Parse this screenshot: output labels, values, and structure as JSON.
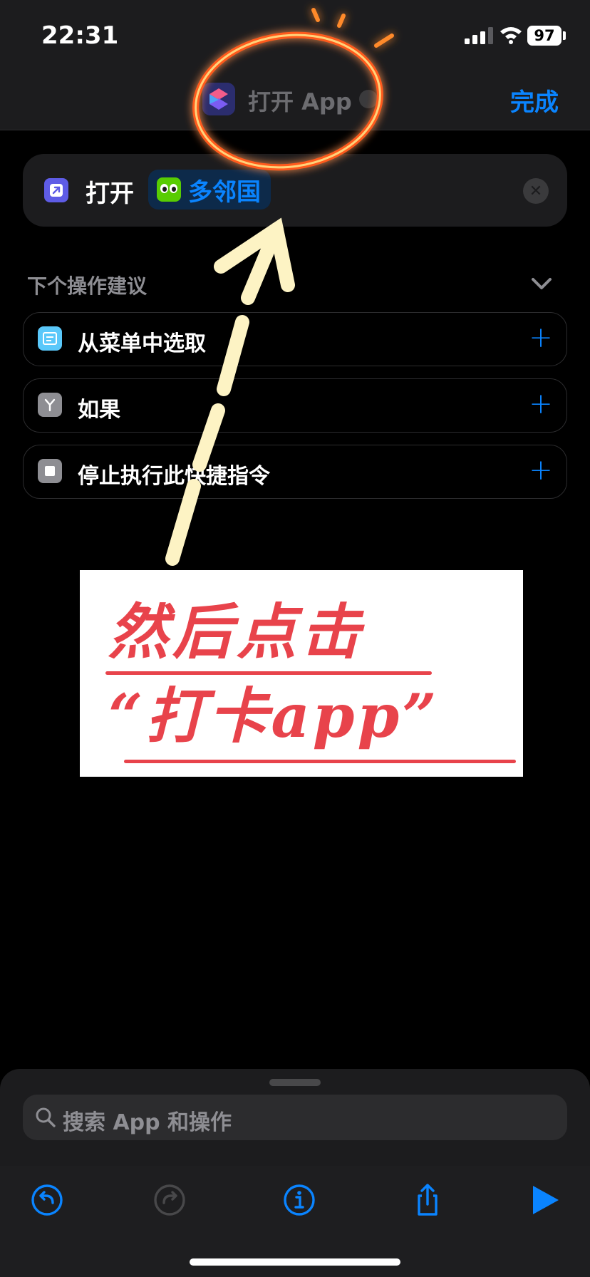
{
  "status_bar": {
    "time": "22:31",
    "battery": "97"
  },
  "nav": {
    "title": "打开 App",
    "done_label": "完成"
  },
  "action": {
    "verb": "打开",
    "app_name": "多邻国"
  },
  "suggestions": {
    "header": "下个操作建议",
    "items": [
      {
        "label": "从菜单中选取",
        "icon": "list-menu-icon",
        "color": "#5ac8fa"
      },
      {
        "label": "如果",
        "icon": "branch-icon",
        "color": "#8e8e93"
      },
      {
        "label": "停止执行此快捷指令",
        "icon": "stop-icon",
        "color": "#8e8e93"
      }
    ]
  },
  "annotation": {
    "line1": "然后点击",
    "line2": "“打卡app”",
    "color": "#e8434b"
  },
  "search": {
    "placeholder": "搜索 App 和操作"
  },
  "toolbar": {
    "buttons": [
      "undo-icon",
      "redo-icon",
      "info-icon",
      "share-icon",
      "play-icon"
    ]
  },
  "colors": {
    "accent": "#0a84ff",
    "background": "#000000",
    "card": "#1c1c1e"
  }
}
